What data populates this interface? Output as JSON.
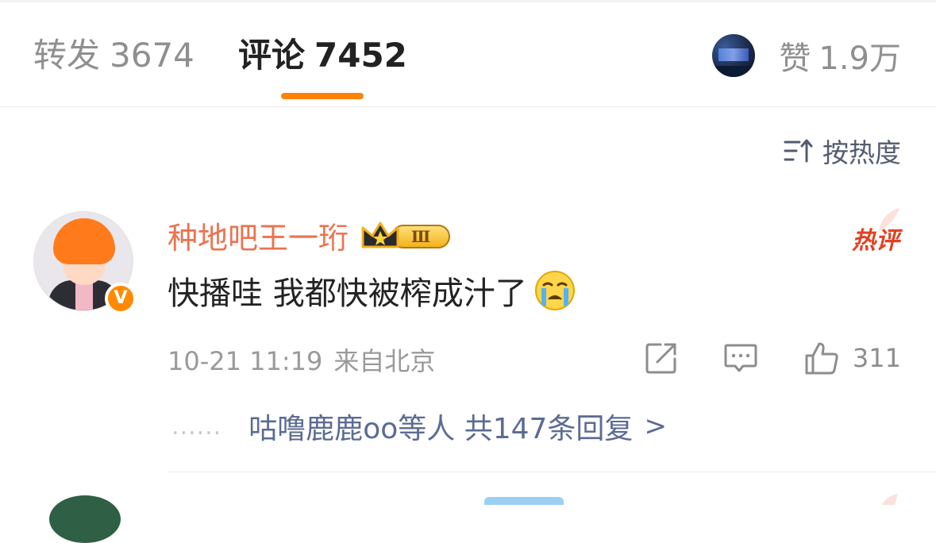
{
  "tabs": {
    "repost": {
      "label": "转发",
      "count": "3674"
    },
    "comment": {
      "label": "评论",
      "count": "7452",
      "active": true
    },
    "like": {
      "label": "赞",
      "count": "1.9万"
    }
  },
  "sort": {
    "label": "按热度",
    "icon": "sort-icon"
  },
  "comments": [
    {
      "username": "种地吧王一珩",
      "level_badge": "Ⅲ",
      "verified_mark": "V",
      "hot_tag": "热评",
      "text": "快播哇 我都快被榨成汁了",
      "emoji": "crying-face-icon",
      "time": "10-21 11:19",
      "source": "来自北京",
      "like_count": "311",
      "replies": {
        "dots": "......",
        "summary": "咕噜鹿鹿oo等人 共147条回复",
        "chevron": ">"
      }
    }
  ],
  "colors": {
    "accent": "#ff8200",
    "username": "#eb7350",
    "hot_tag": "#e14123",
    "reply_link": "#5b6b94",
    "muted": "#9a9a9a"
  }
}
